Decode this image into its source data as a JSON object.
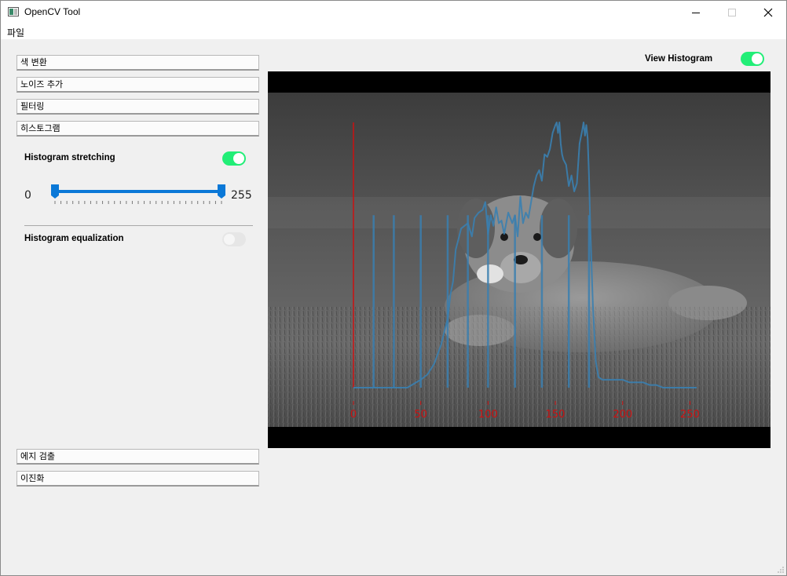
{
  "window": {
    "title": "OpenCV Tool"
  },
  "menu": {
    "file": "파일"
  },
  "sections": {
    "color": "색 변환",
    "noise": "노이즈 추가",
    "filter": "필터링",
    "histogram": "히스토그램",
    "edge": "에지 검출",
    "binarize": "이진화"
  },
  "histogram_panel": {
    "stretching_label": "Histogram stretching",
    "stretching_enabled": true,
    "slider_min": "0",
    "slider_max": "255",
    "range_low": 0,
    "range_high": 255,
    "equalization_label": "Histogram equalization",
    "equalization_enabled": false
  },
  "view": {
    "label": "View Histogram",
    "enabled": true
  },
  "colors": {
    "accent": "#0a78d7",
    "toggle_on": "#22ee77",
    "histogram_line": "#3a7fb0",
    "axis": "#cc1111"
  },
  "chart_data": {
    "type": "line",
    "xlim": [
      0,
      255
    ],
    "x_ticks": [
      "0",
      "50",
      "100",
      "150",
      "200",
      "250"
    ],
    "x_tick_values": [
      0,
      50,
      100,
      150,
      200,
      250
    ],
    "series": [
      {
        "x": [
          0,
          10,
          20,
          30,
          40,
          50,
          55,
          60,
          65,
          70,
          72,
          74,
          76,
          78,
          80,
          85,
          88,
          90,
          93,
          96,
          98,
          100,
          102,
          104,
          106,
          108,
          110,
          112,
          115,
          118,
          120,
          122,
          124,
          126,
          128,
          130,
          132,
          134,
          136,
          138,
          140,
          142,
          144,
          146,
          148,
          150,
          151,
          152,
          153,
          154,
          155,
          156,
          157,
          158,
          160,
          162,
          164,
          166,
          168,
          170,
          171,
          172,
          173,
          174,
          175,
          176,
          178,
          180,
          182,
          185,
          190,
          195,
          200,
          205,
          210,
          215,
          220,
          225,
          230,
          235,
          240,
          245,
          255
        ],
        "y": [
          0,
          0,
          0,
          0,
          0,
          0.03,
          0.05,
          0.09,
          0.16,
          0.26,
          0.35,
          0.4,
          0.52,
          0.56,
          0.6,
          0.62,
          0.57,
          0.64,
          0.66,
          0.67,
          0.7,
          0.58,
          0.65,
          0.61,
          0.68,
          0.62,
          0.63,
          0.58,
          0.66,
          0.62,
          0.65,
          0.57,
          0.72,
          0.62,
          0.66,
          0.64,
          0.7,
          0.76,
          0.8,
          0.82,
          0.78,
          0.88,
          0.87,
          0.9,
          0.96,
          0.99,
          1.0,
          0.96,
          1.0,
          0.92,
          0.88,
          0.86,
          0.85,
          0.84,
          0.76,
          0.8,
          0.74,
          0.77,
          0.92,
          0.97,
          1.0,
          0.95,
          0.99,
          0.94,
          0.8,
          0.6,
          0.3,
          0.1,
          0.04,
          0.03,
          0.03,
          0.03,
          0.03,
          0.02,
          0.02,
          0.02,
          0.01,
          0.01,
          0.0,
          0.0,
          0.0,
          0.0,
          0.0
        ]
      }
    ]
  }
}
